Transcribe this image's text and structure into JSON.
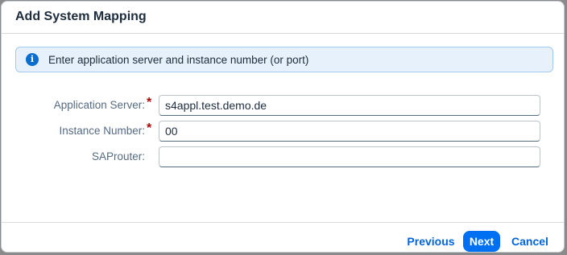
{
  "dialog": {
    "title": "Add System Mapping"
  },
  "info": {
    "icon": "info-icon",
    "glyph": "i",
    "message": "Enter application server and instance number (or port)"
  },
  "form": {
    "application_server": {
      "label": "Application Server:",
      "required_marker": "*",
      "value": "s4appl.test.demo.de"
    },
    "instance_number": {
      "label": "Instance Number:",
      "required_marker": "*",
      "value": "00"
    },
    "saprouter": {
      "label": "SAProuter:",
      "value": ""
    }
  },
  "footer": {
    "previous_label": "Previous",
    "next_label": "Next",
    "cancel_label": "Cancel"
  },
  "colors": {
    "accent": "#0070f2",
    "link": "#0064d9",
    "required": "#aa0808",
    "info_background": "#e6f1fb"
  }
}
